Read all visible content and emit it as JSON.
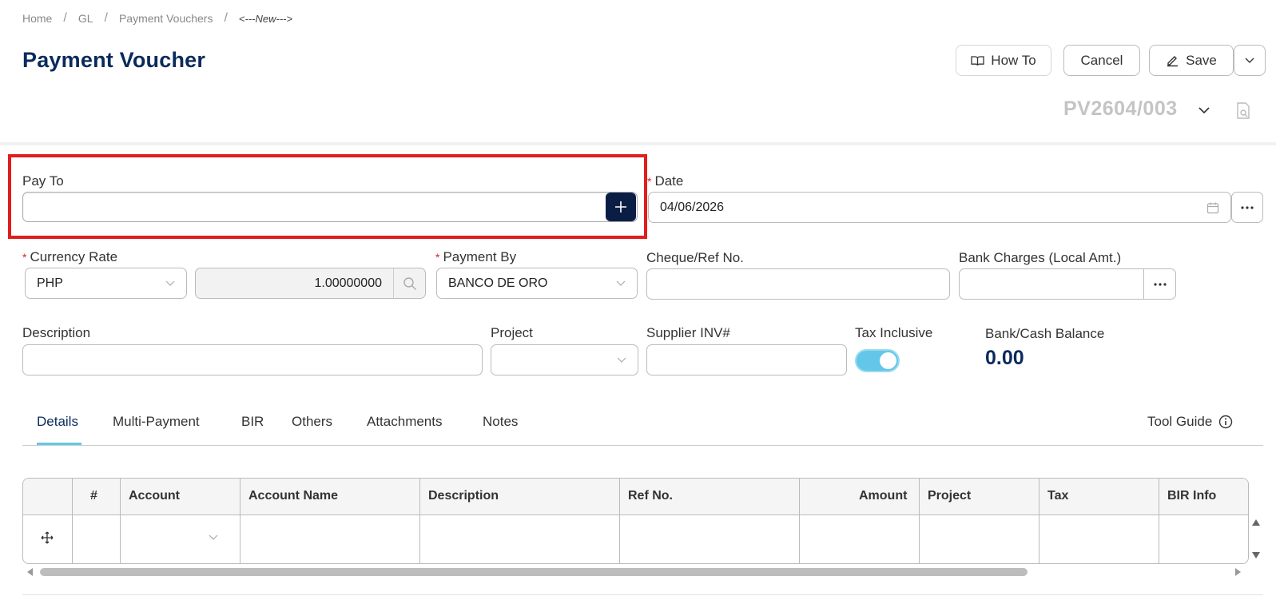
{
  "breadcrumb": {
    "home": "Home",
    "gl": "GL",
    "section": "Payment Vouchers",
    "current": "<---New--->"
  },
  "page_title": "Payment Voucher",
  "toolbar": {
    "howto_label": "How To",
    "cancel_label": "Cancel",
    "save_label": "Save"
  },
  "doc_number": "PV2604/003",
  "form": {
    "pay_to": {
      "label": "Pay To",
      "value": ""
    },
    "date": {
      "label": "Date",
      "value": "04/06/2026",
      "required": true
    },
    "currency_rate": {
      "label": "Currency Rate",
      "currency": "PHP",
      "rate": "1.00000000",
      "required": true
    },
    "payment_by": {
      "label": "Payment By",
      "value": "BANCO DE ORO",
      "required": true
    },
    "cheque_ref": {
      "label": "Cheque/Ref No.",
      "value": ""
    },
    "bank_charges": {
      "label": "Bank Charges (Local Amt.)",
      "value": ""
    },
    "description": {
      "label": "Description",
      "value": ""
    },
    "project": {
      "label": "Project",
      "value": ""
    },
    "supplier_inv": {
      "label": "Supplier INV#",
      "value": ""
    },
    "tax_inclusive": {
      "label": "Tax Inclusive",
      "on": true
    },
    "bank_balance": {
      "label": "Bank/Cash Balance",
      "value": "0.00"
    }
  },
  "tabs": [
    "Details",
    "Multi-Payment",
    "BIR",
    "Others",
    "Attachments",
    "Notes"
  ],
  "active_tab": "Details",
  "tool_guide_label": "Tool Guide",
  "grid": {
    "columns": [
      "#",
      "Account",
      "Account Name",
      "Description",
      "Ref No.",
      "Amount",
      "Project",
      "Tax",
      "BIR Info"
    ]
  },
  "colors": {
    "primary": "#0b2a5c",
    "accent": "#62c7e8",
    "highlight": "#e01e1e",
    "required": "#e02424"
  }
}
